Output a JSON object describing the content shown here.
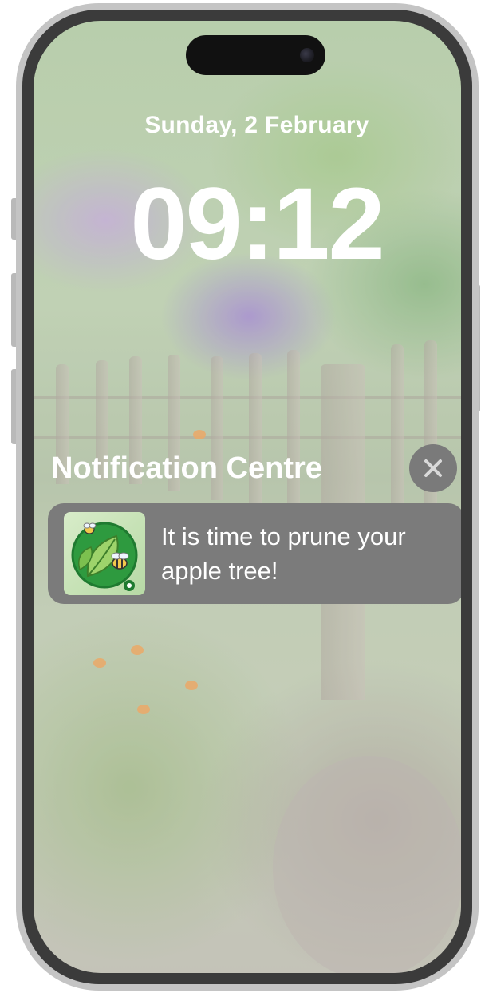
{
  "lock_screen": {
    "date": "Sunday, 2 February",
    "time": "09:12"
  },
  "notification_centre": {
    "title": "Notification Centre",
    "close_icon": "x-icon",
    "notifications": [
      {
        "app_icon": "leaf-bee-app-icon",
        "message": "It is time to prune your apple tree!"
      }
    ]
  },
  "colors": {
    "bezel": "#3b3b3b",
    "frame": "#c4c4c4",
    "notification_bg": "#7b7b7b",
    "close_button_bg": "#7a7a7a",
    "text": "#ffffff",
    "app_icon_green": "#2e9a3f"
  }
}
